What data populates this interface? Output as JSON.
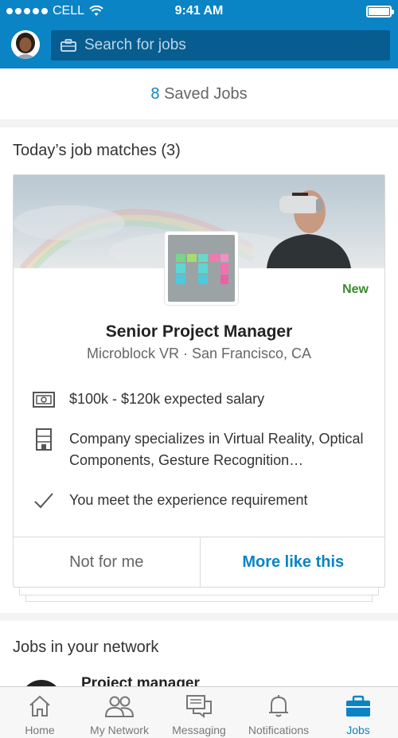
{
  "status_bar": {
    "carrier": "CELL",
    "time": "9:41 AM"
  },
  "search": {
    "placeholder": "Search for jobs"
  },
  "saved_jobs": {
    "count": "8",
    "label": "Saved Jobs"
  },
  "matches": {
    "title": "Today’s job matches (3)",
    "card": {
      "badge": "New",
      "job_title": "Senior Project Manager",
      "company_location": "Microblock VR · San Francisco, CA",
      "insights": [
        {
          "icon": "salary-icon",
          "text": "$100k - $120k expected salary"
        },
        {
          "icon": "building-icon",
          "text": "Company specializes in Virtual Reality, Optical Components, Gesture Recognition…"
        },
        {
          "icon": "checkmark-icon",
          "text": "You meet the experience requirement"
        }
      ],
      "actions": {
        "dismiss": "Not for me",
        "more": "More like this"
      }
    }
  },
  "network": {
    "title": "Jobs in your network",
    "first_job": "Project manager"
  },
  "tabs": [
    {
      "label": "Home",
      "icon": "home-icon"
    },
    {
      "label": "My Network",
      "icon": "network-icon"
    },
    {
      "label": "Messaging",
      "icon": "messaging-icon"
    },
    {
      "label": "Notifications",
      "icon": "bell-icon"
    },
    {
      "label": "Jobs",
      "icon": "briefcase-icon",
      "active": true
    }
  ],
  "colors": {
    "brand": "#0a84c5",
    "search_bg": "#075d8f",
    "new_badge": "#3a8a2e"
  }
}
